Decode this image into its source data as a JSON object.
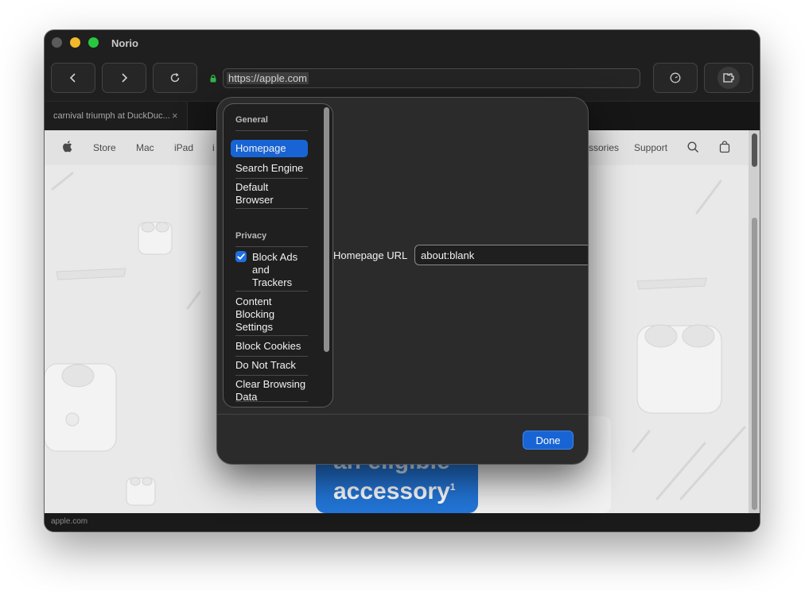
{
  "window": {
    "title": "Norio"
  },
  "toolbar": {
    "url": "https://apple.com"
  },
  "tabs": [
    {
      "label": "carnival triumph at DuckDuc..."
    }
  ],
  "page": {
    "nav": [
      "Store",
      "Mac",
      "iPad",
      "i",
      "ssories",
      "Support"
    ],
    "promo_line1": "an eligible",
    "promo_line2": "accessory",
    "promo_sup": "1"
  },
  "statusbar": {
    "text": "apple.com"
  },
  "settings": {
    "sections": [
      {
        "title": "General",
        "items": [
          "Homepage",
          "Search Engine",
          "Default Browser"
        ]
      },
      {
        "title": "Privacy",
        "items": [
          "Block Ads and Trackers",
          "Content Blocking Settings",
          "Block Cookies",
          "Do Not Track",
          "Clear Browsing Data"
        ]
      }
    ],
    "selected_item": "Homepage",
    "block_ads_checked": true,
    "homepage_label": "Homepage URL",
    "homepage_value": "about:blank",
    "done_label": "Done"
  },
  "colors": {
    "accent": "#1864d4",
    "checkbox": "#1f6fe0"
  }
}
